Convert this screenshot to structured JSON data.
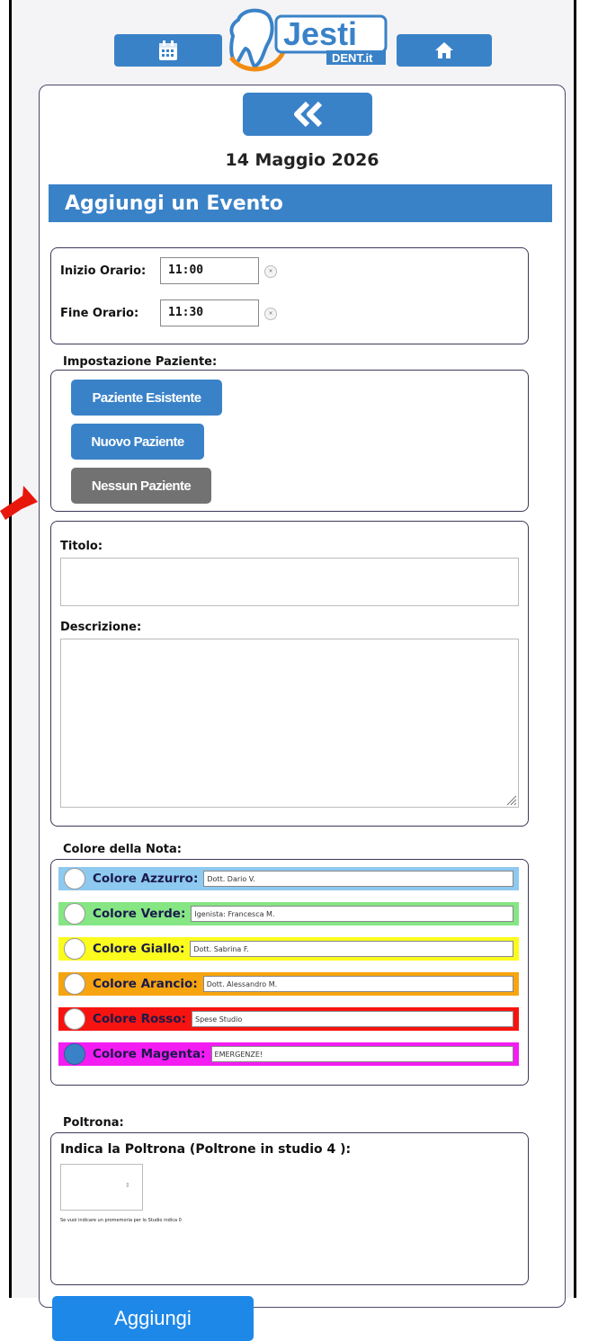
{
  "header": {
    "calendar_icon": "calendar-icon",
    "home_icon": "home-icon",
    "logo_main": "Jesti",
    "logo_sub": "DENT.it"
  },
  "date": "14 Maggio 2026",
  "section_title": "Aggiungi un Evento",
  "time": {
    "start_label": "Inizio Orario:",
    "start_value": "11:00",
    "end_label": "Fine Orario:",
    "end_value": "11:30"
  },
  "patient": {
    "heading": "Impostazione Paziente:",
    "existing": "Paziente Esistente",
    "new": "Nuovo Paziente",
    "none": "Nessun Paziente"
  },
  "form": {
    "title_label": "Titolo:",
    "title_value": "",
    "description_label": "Descrizione:",
    "description_value": ""
  },
  "colors": {
    "heading": "Colore della Nota:",
    "items": [
      {
        "label": "Colore Azzurro:",
        "value": "Dott. Dario V.",
        "bg": "#8ec9f0",
        "selected": false
      },
      {
        "label": "Colore Verde:",
        "value": "Igenista: Francesca M.",
        "bg": "#86e684",
        "selected": false
      },
      {
        "label": "Colore Giallo:",
        "value": "Dott. Sabrina F.",
        "bg": "#fbfc1e",
        "selected": false
      },
      {
        "label": "Colore Arancio:",
        "value": "Dott. Alessandro M.",
        "bg": "#f6a40f",
        "selected": false
      },
      {
        "label": "Colore Rosso:",
        "value": "Spese Studio",
        "bg": "#f71410",
        "selected": false
      },
      {
        "label": "Colore Magenta:",
        "value": "EMERGENZE!",
        "bg": "#f31cf2",
        "selected": true
      }
    ]
  },
  "chair": {
    "heading": "Poltrona:",
    "label": "Indica la Poltrona (Poltrone in studio 4 ):",
    "value": "",
    "hint": "Se vuoi indicare un promemoria per lo Studio indica 0"
  },
  "submit_label": "Aggiungi",
  "theme": {
    "accent": "#3a82c8",
    "submit": "#1e88e8",
    "disabled": "#727272"
  }
}
